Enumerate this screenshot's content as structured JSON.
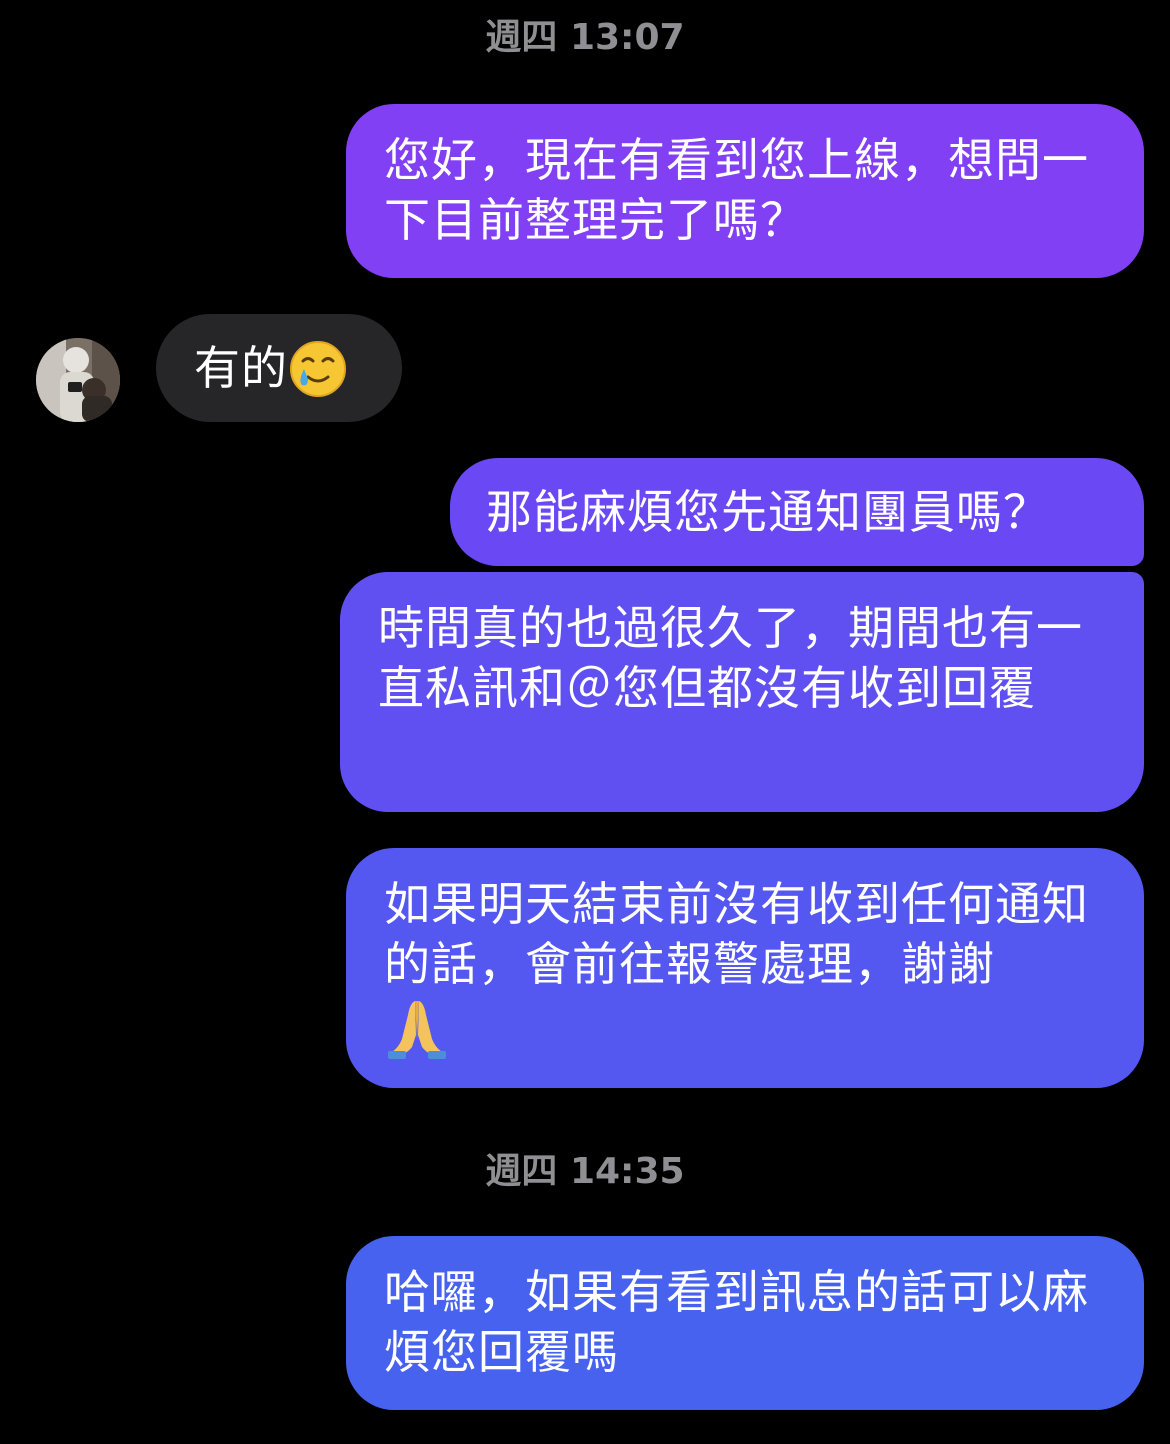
{
  "timestamps": {
    "first": "週四 13:07",
    "second": "週四 14:35"
  },
  "messages": {
    "m1": "您好，現在有看到您上線，想問一下目前整理完了嗎？",
    "m2": "有的",
    "m2_emoji": "smiling-face-with-tear-emoji",
    "m3": "那能麻煩您先通知團員嗎？",
    "m4": "時間真的也過很久了，期間也有一直私訊和＠您但都沒有收到回覆",
    "m5": "如果明天結束前沒有收到任何通知的話，會前往報警處理，謝謝",
    "m5_emoji": "folded-hands-emoji",
    "m6": "哈囉，如果有看到訊息的話可以麻煩您回覆嗎"
  },
  "colors": {
    "background": "#000000",
    "incoming_bubble": "#262629",
    "outgoing_top": "#8140f4",
    "outgoing_bottom": "#4662ef",
    "timestamp": "#8e8e93"
  }
}
